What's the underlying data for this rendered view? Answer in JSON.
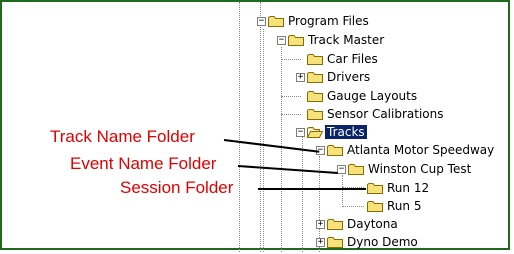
{
  "tree": {
    "items": [
      {
        "label": "Program Files",
        "expander": "−"
      },
      {
        "label": "Track Master",
        "expander": "−"
      },
      {
        "label": "Car Files",
        "expander": ""
      },
      {
        "label": "Drivers",
        "expander": "+"
      },
      {
        "label": "Gauge Layouts",
        "expander": ""
      },
      {
        "label": "Sensor Calibrations",
        "expander": ""
      },
      {
        "label": "Tracks",
        "expander": "−"
      },
      {
        "label": "Atlanta Motor Speedway",
        "expander": "−"
      },
      {
        "label": "Winston Cup Test",
        "expander": "−"
      },
      {
        "label": "Run 12",
        "expander": ""
      },
      {
        "label": "Run 5",
        "expander": ""
      },
      {
        "label": "Daytona",
        "expander": "+"
      },
      {
        "label": "Dyno Demo",
        "expander": "+"
      }
    ]
  },
  "annotations": {
    "track_name": "Track Name Folder",
    "event_name": "Event Name Folder",
    "session": "Session Folder"
  },
  "colors": {
    "annotation_text": "#e00000",
    "frame_border": "#1e6b1e",
    "selection": "#0a246a",
    "folder_fill": "#f7e27a"
  }
}
